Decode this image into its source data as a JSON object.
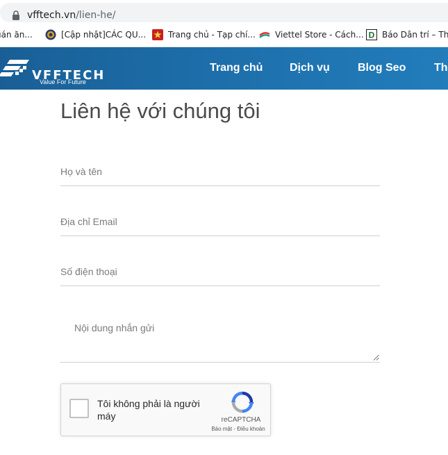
{
  "browser": {
    "url_host": "vfftech.vn",
    "url_path": "/lien-he/",
    "bookmarks": [
      {
        "label": "uán ăn...",
        "icon": "none"
      },
      {
        "label": "[Cập nhật]CÁC QU...",
        "icon": "eye-favicon"
      },
      {
        "label": "Trang chủ - Tạp chí...",
        "icon": "red-emblem-favicon"
      },
      {
        "label": "Viettel Store - Cách...",
        "icon": "viettel-favicon"
      },
      {
        "label": "Báo Dân trí – Thôn",
        "icon": "dantri-favicon"
      }
    ]
  },
  "site": {
    "logo_name": "VFFTECH",
    "logo_tagline": "Value For Future",
    "nav": [
      "Trang chủ",
      "Dịch vụ",
      "Blog Seo",
      "Th"
    ]
  },
  "form": {
    "title": "Liên hệ với chúng tôi",
    "name_placeholder": "Họ và tên",
    "email_placeholder": "Địa chỉ Email",
    "phone_placeholder": "Số điện thoại",
    "message_placeholder": "Nội dung nhắn gửi"
  },
  "recaptcha": {
    "label": "Tôi không phải là người máy",
    "brand": "reCAPTCHA",
    "terms": "Bảo mật - Điều khoản"
  },
  "colors": {
    "header_start": "#195f96",
    "header_end": "#227dbb",
    "title_text": "#4a4a4a",
    "placeholder_text": "#7a7a7a"
  }
}
